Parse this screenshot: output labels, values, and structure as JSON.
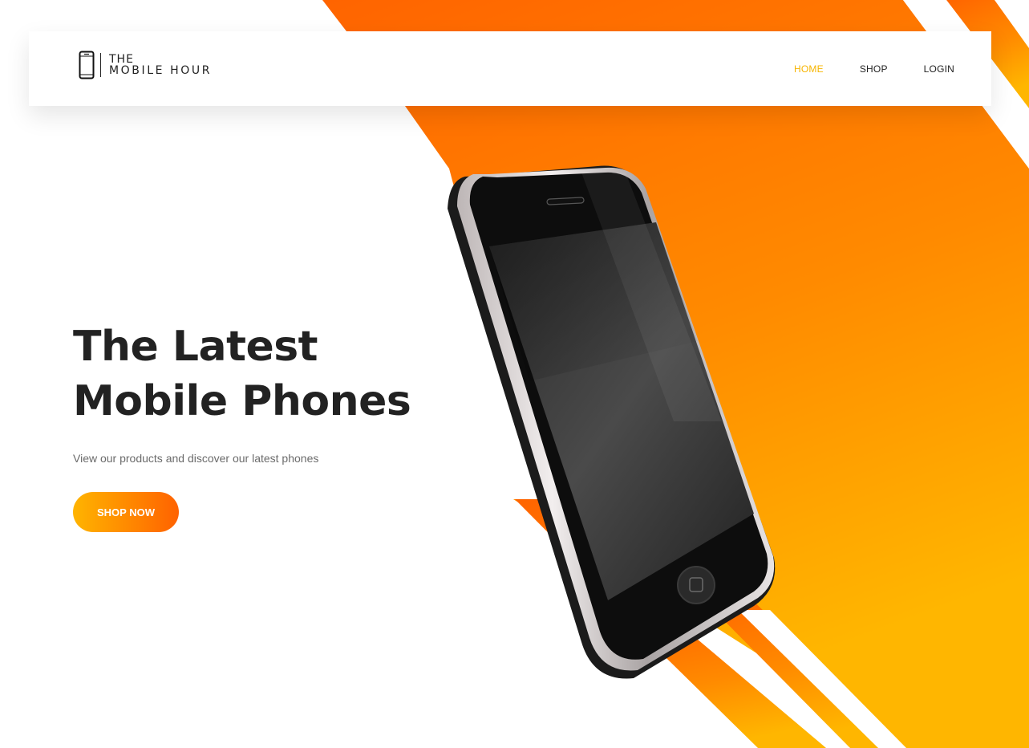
{
  "brand": {
    "line1": "THE",
    "line2": "MOBILE HOUR",
    "logo_icon": "smartphone-icon"
  },
  "nav": {
    "items": [
      {
        "label": "HOME",
        "active": true
      },
      {
        "label": "SHOP",
        "active": false
      },
      {
        "label": "LOGIN",
        "active": false
      }
    ]
  },
  "hero": {
    "title_line1": "The Latest",
    "title_line2": "Mobile Phones",
    "subtitle": "View our products and discover our latest phones",
    "cta_label": "SHOP NOW",
    "image": "smartphone-illustration"
  },
  "colors": {
    "accent": "#f7b500",
    "orange": "#ff6a00",
    "orange_light": "#ffb400",
    "text_dark": "#222222",
    "text_muted": "#6b6b6b"
  }
}
